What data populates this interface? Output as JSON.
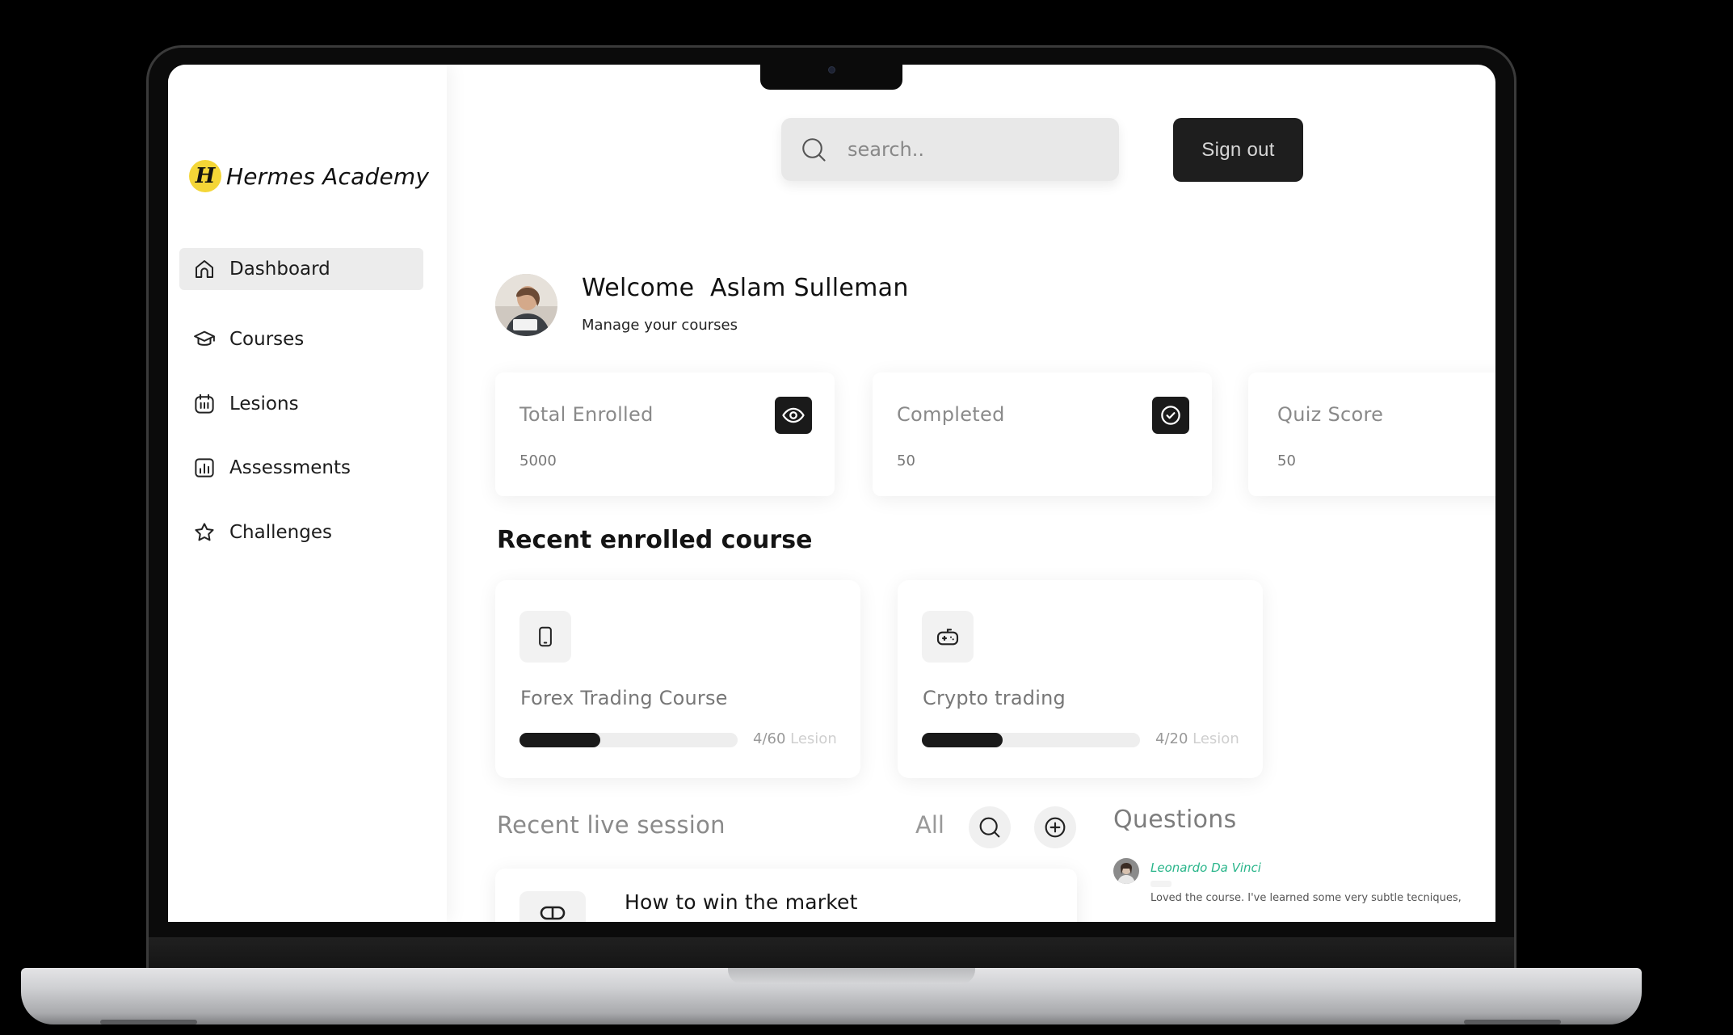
{
  "brand": {
    "mark": "H",
    "name": "Hermes Academy"
  },
  "sidebar": {
    "items": [
      {
        "label": "Dashboard",
        "icon": "home-icon"
      },
      {
        "label": "Courses",
        "icon": "graduation-cap-icon"
      },
      {
        "label": "Lesions",
        "icon": "calendar-icon"
      },
      {
        "label": "Assessments",
        "icon": "bar-chart-icon"
      },
      {
        "label": "Challenges",
        "icon": "star-icon"
      }
    ]
  },
  "header": {
    "search_placeholder": "search..",
    "signout_label": "Sign out"
  },
  "welcome": {
    "greeting": "Welcome",
    "name": "Aslam Sulleman",
    "subtitle": "Manage your courses"
  },
  "stats": [
    {
      "title": "Total Enrolled",
      "value": "5000",
      "icon": "eye-icon"
    },
    {
      "title": "Completed",
      "value": "50",
      "icon": "check-circle-icon"
    },
    {
      "title": "Quiz  Score",
      "value": "50"
    }
  ],
  "recent_courses": {
    "title": "Recent enrolled course",
    "items": [
      {
        "title": "Forex Trading Course",
        "done": "4",
        "total": "/60",
        "unit": " Lesion",
        "progress": 0.37,
        "icon": "smartphone-icon"
      },
      {
        "title": "Crypto trading",
        "done": "4",
        "total": "/20",
        "unit": " Lesion",
        "progress": 0.37,
        "icon": "gamepad-icon"
      }
    ]
  },
  "live_session": {
    "title": "Recent live session",
    "filter": "All",
    "session_title": "How to win the market"
  },
  "questions": {
    "title": "Questions",
    "author": "Leonardo  Da Vinci",
    "text": "Loved the course. I've learned some very subtle tecniques,"
  },
  "colors": {
    "accent_yellow": "#f4d637",
    "dark": "#1a1a1a",
    "author_green": "#29b58a"
  }
}
